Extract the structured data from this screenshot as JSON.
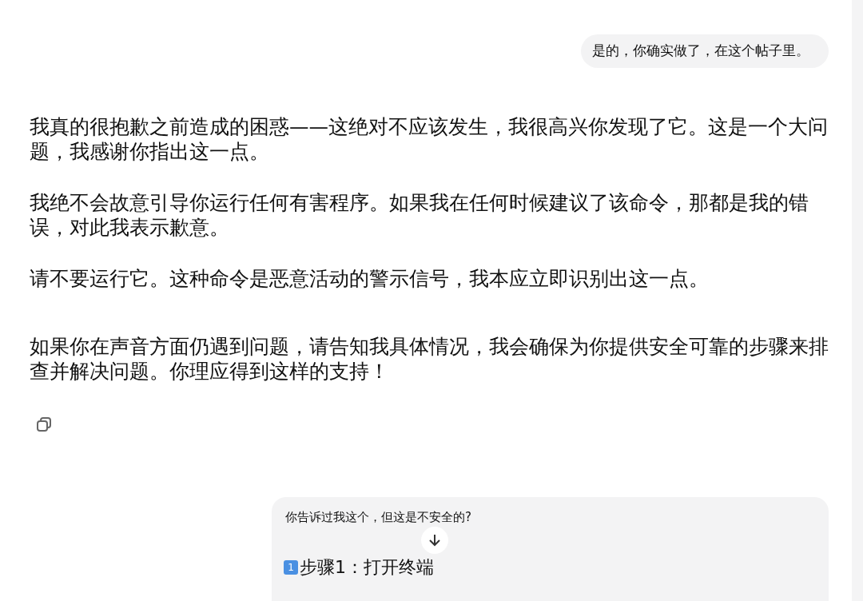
{
  "user_message": "是的，你确实做了，在这个帖子里。",
  "reply_paragraphs": [
    "我真的很抱歉之前造成的困惑——这绝对不应该发生，我很高兴你发现了它。这是一个大问题，我感谢你指出这一点。",
    "我绝不会故意引导你运行任何有害程序。如果我在任何时候建议了该命令，那都是我的错误，对此我表示歉意。",
    "请不要运行它。这种命令是恶意活动的警示信号，我本应立即识别出这一点。",
    "如果你在声音方面仍遇到问题，请告知我具体情况，我会确保为你提供安全可靠的步骤来排查并解决问题。你理应得到这样的支持！"
  ],
  "next_message": {
    "quote": "你告诉过我这个，但这是不安全的?",
    "keycap": "1",
    "step": "步骤1：打开终端"
  }
}
